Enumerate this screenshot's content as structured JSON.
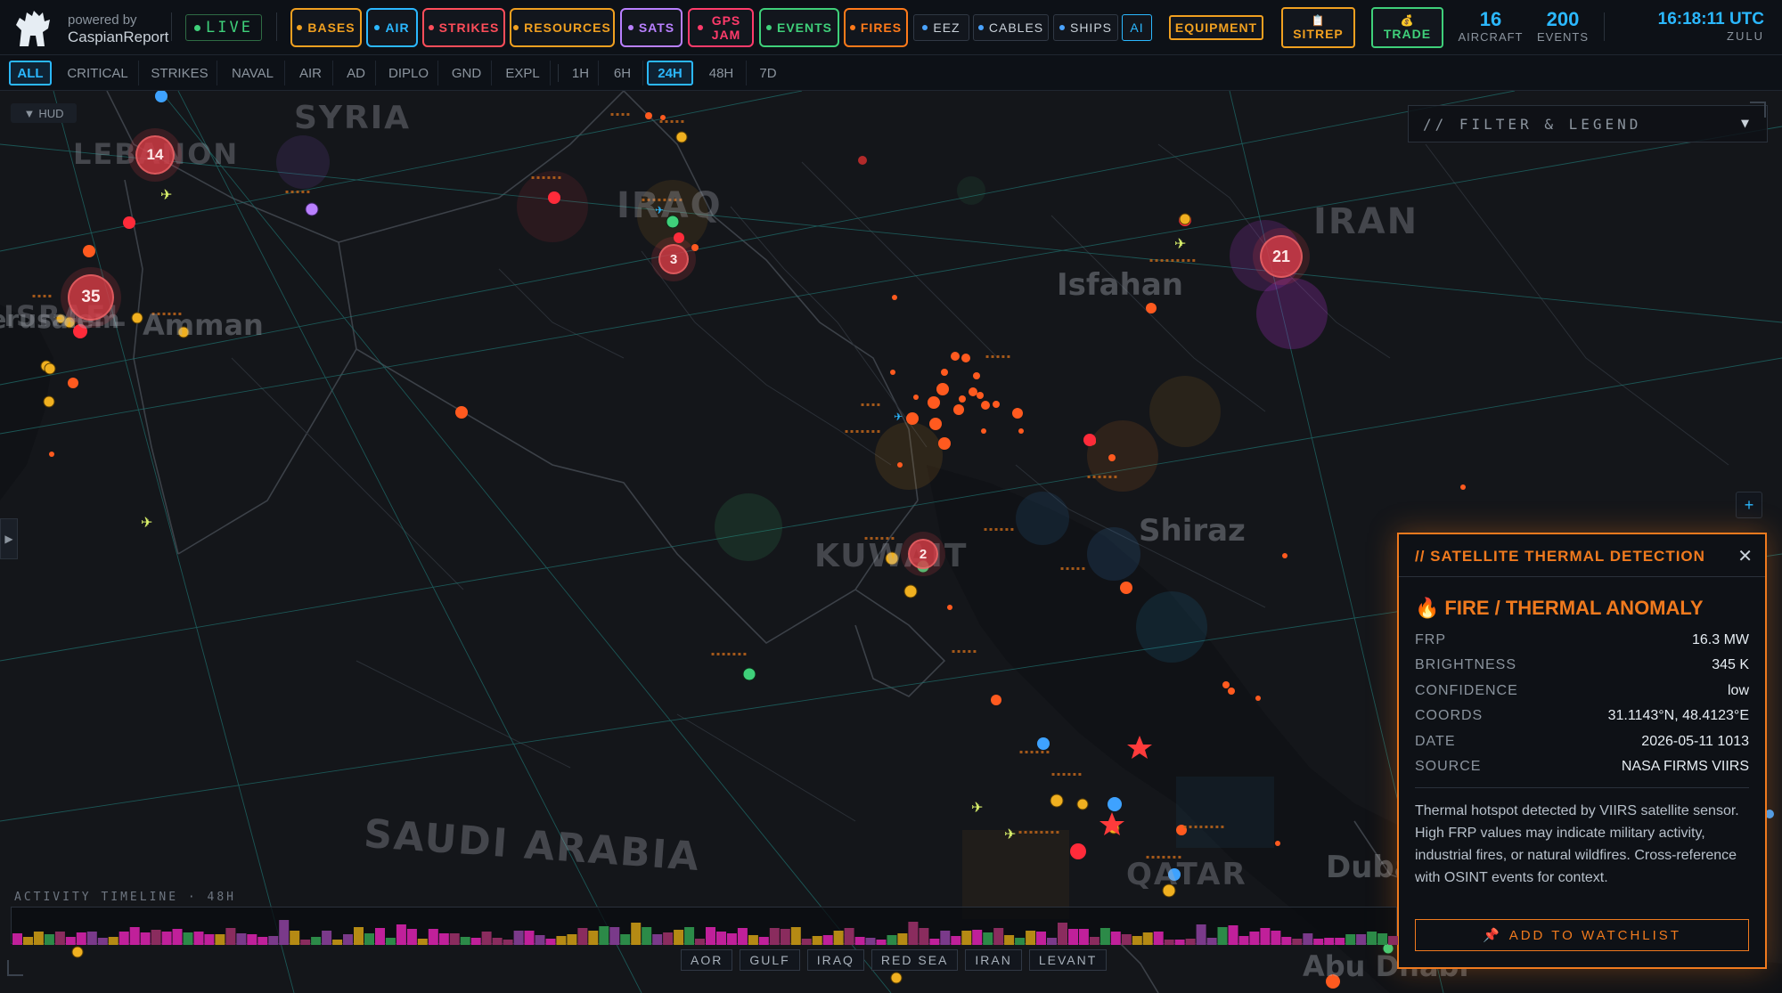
{
  "brand": {
    "powered_by": "powered by",
    "name": "CaspianReport"
  },
  "live": {
    "label": "LIVE"
  },
  "layers": [
    {
      "id": "bases",
      "label": "BASES",
      "color": "#f0a020"
    },
    {
      "id": "air",
      "label": "AIR",
      "color": "#2bb8ff"
    },
    {
      "id": "strikes",
      "label": "STRIKES",
      "color": "#ff4d5a"
    },
    {
      "id": "resources",
      "label": "RESOURCES",
      "color": "#f0a020"
    },
    {
      "id": "sats",
      "label": "SATS",
      "color": "#b980ff"
    },
    {
      "id": "gpsjam",
      "label": "GPS JAM",
      "color": "#ff3b6b"
    },
    {
      "id": "events",
      "label": "EVENTS",
      "color": "#3fd07a"
    },
    {
      "id": "fires",
      "label": "FIRES",
      "color": "#ff7a1a"
    }
  ],
  "extra_layers": [
    {
      "id": "eez",
      "label": "EEZ"
    },
    {
      "id": "cables",
      "label": "CABLES"
    },
    {
      "id": "ships",
      "label": "SHIPS"
    }
  ],
  "ai_label": "AI",
  "equipment_label": "EQUIPMENT",
  "sitrep": {
    "icon": "📋",
    "label": "SITREP"
  },
  "trade": {
    "icon": "💰",
    "label": "TRADE"
  },
  "stats": {
    "aircraft": {
      "value": "16",
      "label": "AIRCRAFT"
    },
    "events": {
      "value": "200",
      "label": "EVENTS"
    }
  },
  "clock": {
    "time": "16:18:11 UTC",
    "zone": "ZULU"
  },
  "filters": {
    "types": [
      "ALL",
      "CRITICAL",
      "STRIKES",
      "NAVAL",
      "AIR",
      "AD",
      "DIPLO",
      "GND",
      "EXPL"
    ],
    "active_type": "ALL",
    "ranges": [
      "1H",
      "6H",
      "24H",
      "48H",
      "7D"
    ],
    "active_range": "24H"
  },
  "hud_label": "HUD",
  "legend_title": "// FILTER & LEGEND",
  "map": {
    "countries": [
      "SYRIA",
      "LEBANON",
      "IRAQ",
      "IRAN",
      "ISRAEL",
      "KUWAIT",
      "SAUDI ARABIA",
      "QATAR"
    ],
    "cities": [
      "Amman",
      "Jerusalem",
      "Isfahan",
      "Shiraz",
      "Dubai",
      "Abu Dhabi"
    ],
    "clusters": [
      {
        "id": "lebanon",
        "count": "14"
      },
      {
        "id": "jerusalem",
        "count": "35"
      },
      {
        "id": "iraq",
        "count": "3"
      },
      {
        "id": "iran",
        "count": "21"
      },
      {
        "id": "kuwait",
        "count": "2"
      }
    ]
  },
  "detail": {
    "header": "// SATELLITE THERMAL DETECTION",
    "icon": "🔥",
    "title": "FIRE / THERMAL ANOMALY",
    "fields": [
      {
        "key": "FRP",
        "value": "16.3 MW"
      },
      {
        "key": "BRIGHTNESS",
        "value": "345 K"
      },
      {
        "key": "CONFIDENCE",
        "value": "low"
      },
      {
        "key": "COORDS",
        "value": "31.1143°N, 48.4123°E"
      },
      {
        "key": "DATE",
        "value": "2026-05-11 1013"
      },
      {
        "key": "SOURCE",
        "value": "NASA FIRMS VIIRS"
      }
    ],
    "description": "Thermal hotspot detected by VIIRS satellite sensor. High FRP values may indicate military activity, industrial fires, or natural wildfires. Cross-reference with OSINT events for context.",
    "watch_icon": "📌",
    "watch_label": "ADD TO WATCHLIST"
  },
  "timeline": {
    "title": "ACTIVITY TIMELINE · 48H",
    "regions": [
      "AOR",
      "GULF",
      "IRAQ",
      "RED SEA",
      "IRAN",
      "LEVANT"
    ]
  },
  "colors": {
    "accent": "#2bb8ff",
    "fire": "#f07a1e",
    "live": "#3fd07a",
    "strike": "#ff4d5a"
  }
}
